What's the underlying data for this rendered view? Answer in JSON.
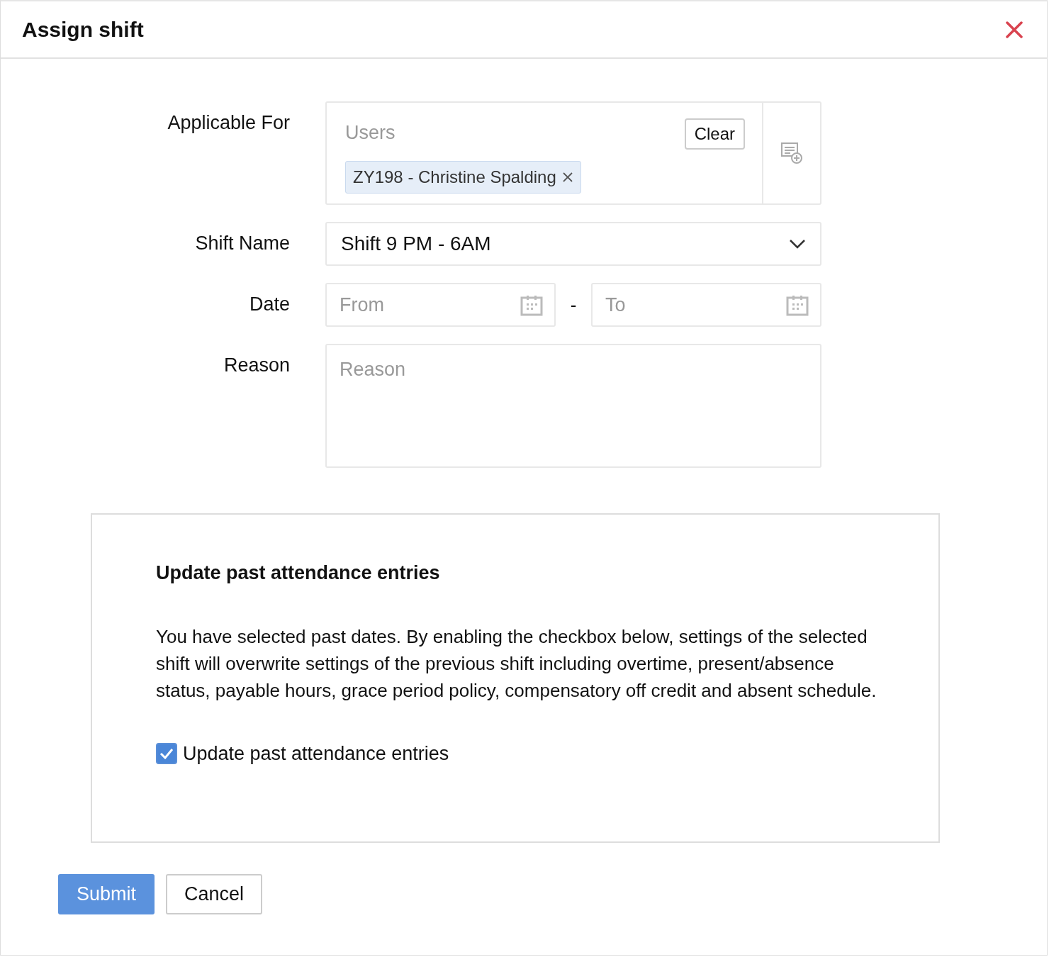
{
  "dialog": {
    "title": "Assign shift"
  },
  "fields": [
    {
      "kind": "users",
      "label": "Applicable For",
      "placeholder": "Users",
      "clear_button": "Clear",
      "tags": [
        {
          "text": "ZY198 - Christine Spalding"
        }
      ]
    },
    {
      "kind": "select",
      "label": "Shift Name",
      "value": "Shift 9 PM - 6AM"
    },
    {
      "kind": "daterange",
      "label": "Date",
      "from_placeholder": "From",
      "separator": "-",
      "to_placeholder": "To"
    },
    {
      "kind": "textarea",
      "label": "Reason",
      "placeholder": "Reason"
    }
  ],
  "notice": {
    "title": "Update past attendance entries",
    "text": "You have selected past dates. By enabling the checkbox below, settings of the selected shift will overwrite settings of the previous shift including overtime, present/absence status, payable hours, grace period policy, compensatory off credit and absent schedule.",
    "checkbox": {
      "label": "Update past attendance entries",
      "checked": true
    }
  },
  "buttons": [
    {
      "kind": "primary",
      "label": "Submit"
    },
    {
      "kind": "secondary",
      "label": "Cancel"
    }
  ]
}
